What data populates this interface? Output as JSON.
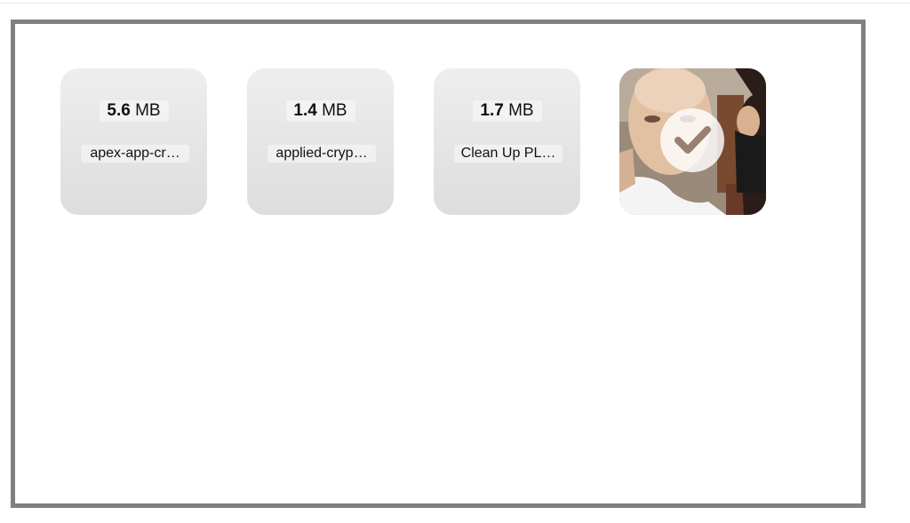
{
  "dropzone": {
    "files": [
      {
        "size_value": "5.6",
        "size_unit": "MB",
        "name": "apex-app-cr…"
      },
      {
        "size_value": "1.4",
        "size_unit": "MB",
        "name": "applied-cryp…"
      },
      {
        "size_value": "1.7",
        "size_unit": "MB",
        "name": "Clean Up PL…"
      }
    ],
    "image_preview": {
      "state": "uploaded",
      "icon": "checkmark-icon"
    }
  },
  "colors": {
    "border": "#808080",
    "card_top": "#eeeeee",
    "card_bottom": "#dddddd"
  }
}
